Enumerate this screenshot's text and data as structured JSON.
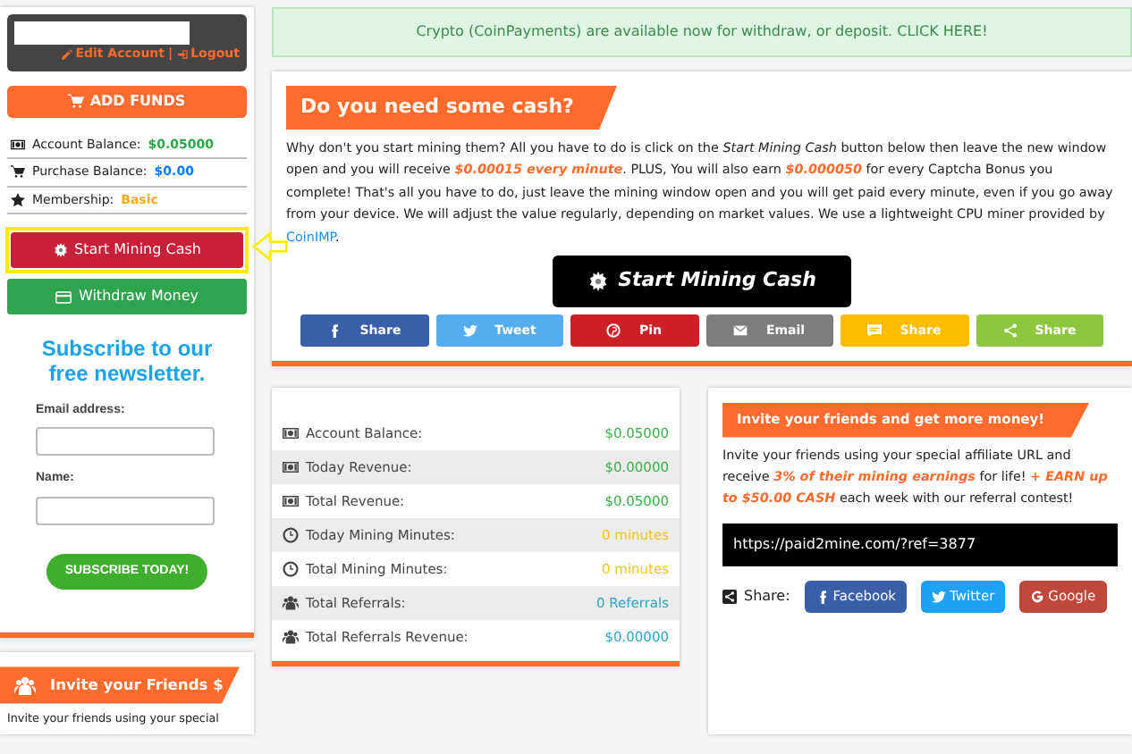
{
  "sidebar": {
    "user_links": [
      {
        "kind": "edit",
        "label": "Edit Account"
      },
      {
        "kind": "logout",
        "label": "Logout"
      }
    ],
    "separator": "|",
    "add_funds": "ADD FUNDS",
    "balances": [
      {
        "kind": "money",
        "label": "Account Balance:",
        "value": "$0.05000",
        "color": "#28a745"
      },
      {
        "kind": "cart",
        "label": "Purchase Balance:",
        "value": "$0.00",
        "color": "#007bff"
      },
      {
        "kind": "star",
        "label": "Membership:",
        "value": "Basic",
        "color": "#f0ad1e"
      }
    ],
    "start_mining": "Start Mining Cash",
    "withdraw": "Withdraw Money",
    "newsletter": {
      "title": "Subscribe to our free newsletter.",
      "fields": [
        {
          "label": "Email address:"
        },
        {
          "label": "Name:"
        }
      ],
      "button": "SUBSCRIBE TODAY!"
    },
    "invite": {
      "title": "Invite your Friends $",
      "text": "Invite your friends using your special"
    }
  },
  "notice": "Crypto (CoinPayments) are available now for withdraw, or deposit. CLICK HERE!",
  "mining": {
    "title": "Do you need some cash?",
    "text": "Why don't you start mining them? All you have to do is click on the *Start Mining Cash* button below then leave the new window open and you will receive **$0.00015 every minute**. PLUS, You will also earn **$0.000050** for every Captcha Bonus you complete! That's all you have to do, just leave the mining window open and you will get paid every minute, even if you go away from your device. We will adjust the value regularly, depending on market values. We use a lightweight CPU miner provided by",
    "link": "CoinIMP",
    "after": ".",
    "button": "Start Mining Cash",
    "shares": [
      {
        "kind": "facebook",
        "label": "Share"
      },
      {
        "kind": "twitter",
        "label": "Tweet"
      },
      {
        "kind": "pinterest",
        "label": "Pin"
      },
      {
        "kind": "email",
        "label": "Email"
      },
      {
        "kind": "sms",
        "label": "Share"
      },
      {
        "kind": "share",
        "label": "Share"
      }
    ]
  },
  "stats": [
    {
      "kind": "money",
      "label": "Account Balance:",
      "value": "$0.05000",
      "color": "#3cb04a"
    },
    {
      "kind": "money",
      "label": "Today Revenue:",
      "value": "$0.00000",
      "color": "#3cb04a"
    },
    {
      "kind": "money",
      "label": "Total Revenue:",
      "value": "$0.05000",
      "color": "#3cb04a"
    },
    {
      "kind": "clock",
      "label": "Today Mining Minutes:",
      "value": "0 minutes",
      "color": "#f5c518"
    },
    {
      "kind": "clock",
      "label": "Total Mining Minutes:",
      "value": "0 minutes",
      "color": "#f5c518"
    },
    {
      "kind": "users",
      "label": "Total Referrals:",
      "value": "0 Referrals",
      "color": "#2fa4c9"
    },
    {
      "kind": "users",
      "label": "Total Referrals Revenue:",
      "value": "$0.00000",
      "color": "#2fa4c9"
    }
  ],
  "referral": {
    "title": "Invite your friends and get more money!",
    "text": "Invite your friends using your special affiliate URL and receive **3% of their mining earnings** for life! **+ EARN up to $50.00 CASH** each week with our referral contest!",
    "url": "https://paid2mine.com/?ref=3877",
    "share_label": "Share:",
    "buttons": [
      {
        "kind": "facebook",
        "label": "Facebook"
      },
      {
        "kind": "twitter",
        "label": "Twitter"
      },
      {
        "kind": "google",
        "label": "Google"
      }
    ]
  }
}
